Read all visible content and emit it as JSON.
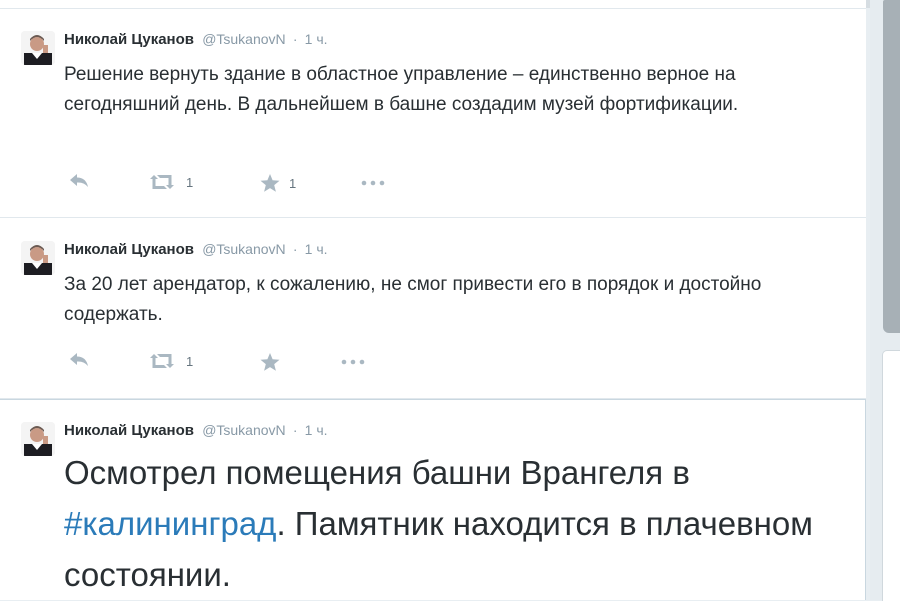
{
  "colors": {
    "accent": "#2b7bb9",
    "text": "#292f33",
    "muted": "#8899a6"
  },
  "tweets": [
    {
      "author": "Николай Цуканов",
      "handle": "@TsukanovN",
      "separator": "·",
      "time": "1 ч.",
      "text": "Решение вернуть здание в областное управление – единственно верное на сегодняшний день. В дальнейшем в башне создадим музей фортификации.",
      "retweets": "1",
      "favorites": "1",
      "icons": [
        "reply-icon",
        "retweet-icon",
        "favorite-icon",
        "more-icon"
      ]
    },
    {
      "author": "Николай Цуканов",
      "handle": "@TsukanovN",
      "separator": "·",
      "time": "1 ч.",
      "text": "За 20 лет арендатор, к сожалению, не смог привести его в порядок и достойно содержать.",
      "retweets": "1",
      "favorites": "",
      "icons": [
        "reply-icon",
        "retweet-icon",
        "favorite-icon",
        "more-icon"
      ]
    },
    {
      "author": "Николай Цуканов",
      "handle": "@TsukanovN",
      "separator": "·",
      "time": "1 ч.",
      "text_before": "Осмотрел помещения башни Врангеля в ",
      "hashtag": "#калининград",
      "text_after": ". Памятник находится в плачевном состоянии."
    }
  ]
}
